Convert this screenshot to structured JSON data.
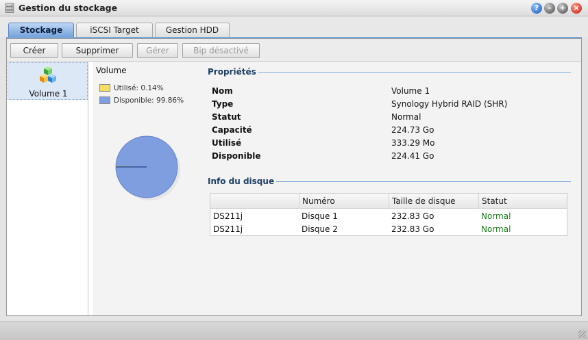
{
  "window": {
    "title": "Gestion du stockage"
  },
  "tabs": [
    {
      "label": "Stockage",
      "active": true
    },
    {
      "label": "iSCSI Target",
      "active": false
    },
    {
      "label": "Gestion HDD",
      "active": false
    }
  ],
  "toolbar": {
    "create_label": "Créer",
    "delete_label": "Supprimer",
    "manage_label": "Gérer",
    "beep_label": "Bip désactivé"
  },
  "volumes": [
    {
      "label": "Volume 1",
      "selected": true
    }
  ],
  "usage": {
    "heading": "Volume",
    "used_label": "Utilisé: 0.14%",
    "available_label": "Disponible: 99.86%",
    "used_percent": 0.14,
    "available_percent": 99.86,
    "used_color": "#f5dc62",
    "available_color": "#7f9ee0"
  },
  "properties": {
    "title": "Propriétés",
    "rows": [
      {
        "key": "Nom",
        "value": "Volume 1"
      },
      {
        "key": "Type",
        "value": "Synology Hybrid RAID (SHR)"
      },
      {
        "key": "Statut",
        "value": "Normal"
      },
      {
        "key": "Capacité",
        "value": "224.73 Go"
      },
      {
        "key": "Utilisé",
        "value": "333.29 Mo"
      },
      {
        "key": "Disponible",
        "value": "224.41 Go"
      }
    ]
  },
  "disk_info": {
    "title": "Info du disque",
    "columns": [
      "",
      "Numéro",
      "Taille de disque",
      "Statut"
    ],
    "rows": [
      [
        "DS211j",
        "Disque 1",
        "232.83 Go",
        "Normal"
      ],
      [
        "DS211j",
        "Disque 2",
        "232.83 Go",
        "Normal"
      ]
    ],
    "status_color": "#1c7d1c"
  },
  "icons": {
    "app": "storage-manager-icon",
    "volume": "volume-cubes-icon",
    "window_buttons": [
      "help-icon",
      "minimize-icon",
      "maximize-icon",
      "close-icon"
    ]
  },
  "accent_color": "#1d3f66"
}
